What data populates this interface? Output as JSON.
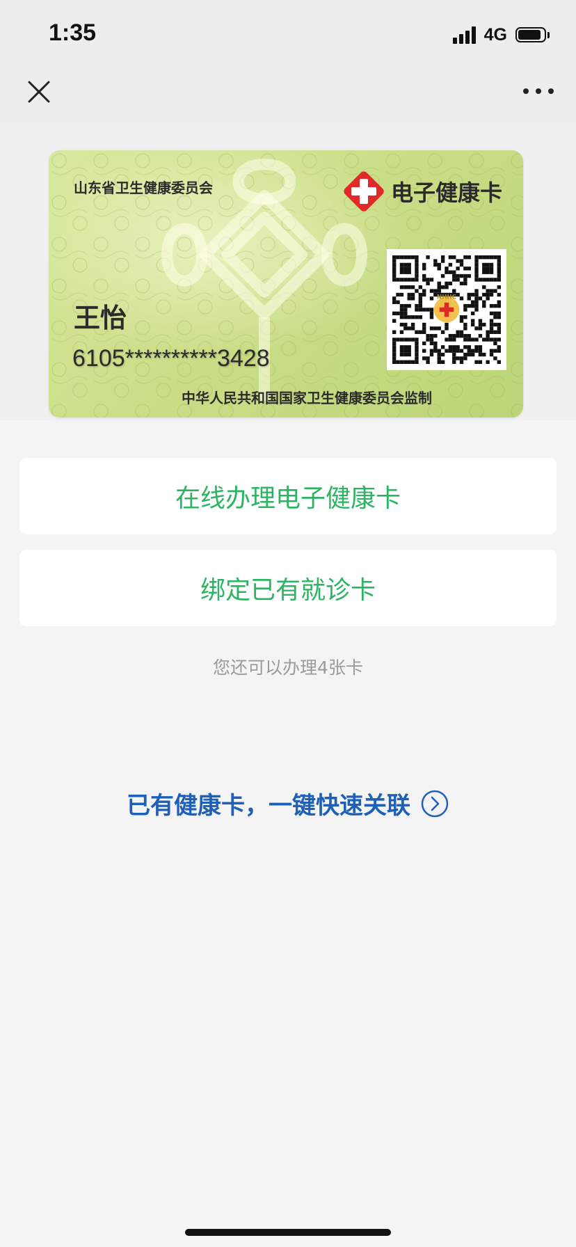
{
  "status_bar": {
    "time": "1:35",
    "network": "4G",
    "battery_level": 0.88
  },
  "nav": {
    "close_icon": "close-icon",
    "more_icon": "more-dots-icon"
  },
  "card": {
    "issuer": "山东省卫生健康委员会",
    "brand_title": "电子健康卡",
    "holder_name": "王怡",
    "holder_id": "6105**********3428",
    "supervisor": "中华人民共和国国家卫生健康委员会监制",
    "qr_logo_text": "NHHC",
    "card_color": "#cfe08e",
    "brand_icon_color": "#e02a2a"
  },
  "actions": {
    "apply_label": "在线办理电子健康卡",
    "bind_label": "绑定已有就诊卡",
    "accent_color": "#2db463"
  },
  "remaining_text": "您还可以办理4张卡",
  "quick_link": {
    "label": "已有健康卡，一键快速关联",
    "color": "#1e5fb8",
    "icon": "chevron-right-circle-icon"
  }
}
